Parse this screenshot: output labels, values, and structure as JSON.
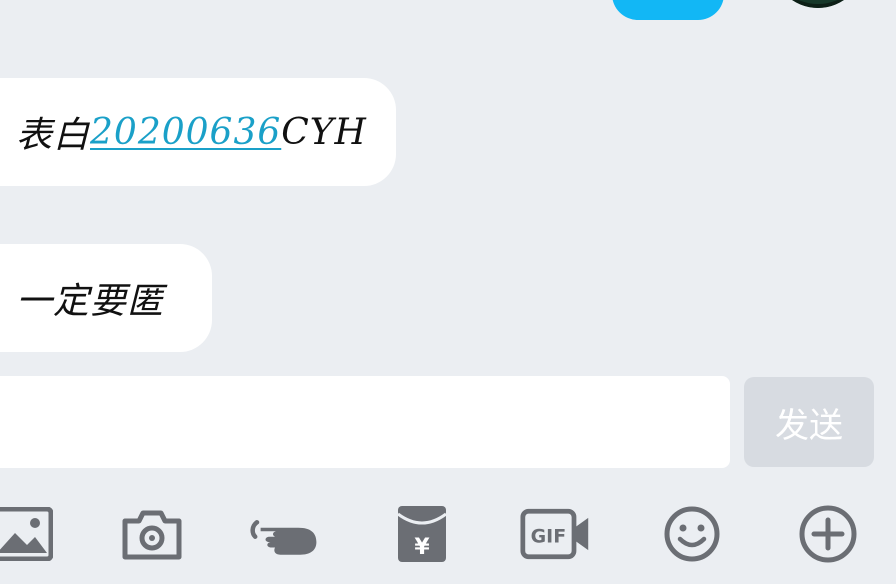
{
  "conversation": {
    "messages": [
      {
        "direction": "received",
        "text_prefix": "表白",
        "link_text": "20200636",
        "text_suffix": "CYH"
      },
      {
        "direction": "received",
        "text": "一定要匿"
      }
    ]
  },
  "composer": {
    "input_value": "",
    "send_label": "发送"
  },
  "toolbar": {
    "items": [
      {
        "icon": "image-icon"
      },
      {
        "icon": "camera-icon"
      },
      {
        "icon": "poke-hand-icon"
      },
      {
        "icon": "red-packet-icon",
        "symbol": "¥"
      },
      {
        "icon": "gif-icon",
        "symbol": "GIF"
      },
      {
        "icon": "emoji-icon"
      },
      {
        "icon": "plus-icon"
      }
    ]
  },
  "colors": {
    "background": "#ebeef2",
    "bubble_received": "#ffffff",
    "bubble_sent": "#12b7f5",
    "link": "#1aa0c8",
    "send_button_disabled": "#d7dbe1",
    "icon": "#6b6e74"
  }
}
